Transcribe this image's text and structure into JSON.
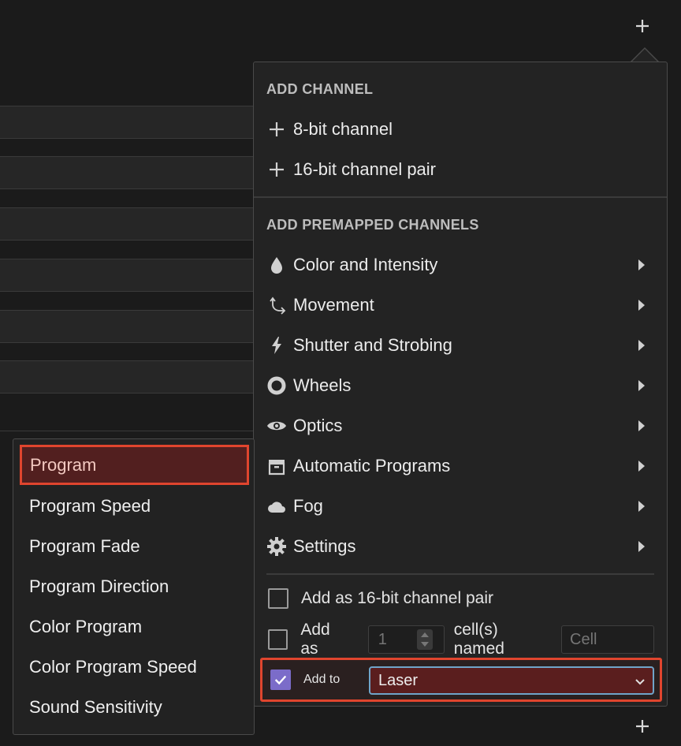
{
  "add_channel_section": {
    "title": "ADD CHANNEL",
    "items": [
      {
        "label": "8-bit channel",
        "icon": "plus-icon"
      },
      {
        "label": "16-bit channel pair",
        "icon": "plus-icon"
      }
    ]
  },
  "premapped_section": {
    "title": "ADD PREMAPPED CHANNELS",
    "items": [
      {
        "label": "Color and Intensity",
        "icon": "droplet-icon"
      },
      {
        "label": "Movement",
        "icon": "movement-arrows-icon"
      },
      {
        "label": "Shutter and Strobing",
        "icon": "lightning-icon"
      },
      {
        "label": "Wheels",
        "icon": "ring-icon"
      },
      {
        "label": "Optics",
        "icon": "eye-icon"
      },
      {
        "label": "Automatic Programs",
        "icon": "archive-box-icon"
      },
      {
        "label": "Fog",
        "icon": "cloud-icon"
      },
      {
        "label": "Settings",
        "icon": "gear-icon"
      }
    ]
  },
  "options": {
    "pair_label": "Add as 16-bit channel pair",
    "pair_checked": false,
    "cells_prefix": "Add as",
    "cells_count_placeholder": "1",
    "cells_suffix": "cell(s) named",
    "cell_name_placeholder": "Cell",
    "cells_checked": false,
    "add_to_label": "Add to",
    "add_to_checked": true,
    "add_to_value": "Laser"
  },
  "submenu": {
    "items": [
      {
        "label": "Program",
        "active": true
      },
      {
        "label": "Program Speed"
      },
      {
        "label": "Program Fade"
      },
      {
        "label": "Program Direction"
      },
      {
        "label": "Color Program"
      },
      {
        "label": "Color Program Speed"
      },
      {
        "label": "Sound Sensitivity"
      }
    ]
  },
  "colors": {
    "accent_highlight": "#e0452e",
    "checkbox_checked": "#7b6cc9",
    "select_border": "#6fa4c9"
  }
}
